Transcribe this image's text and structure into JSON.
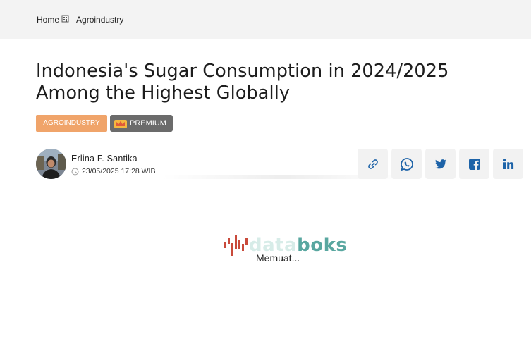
{
  "breadcrumb": {
    "home": "Home",
    "current": "Agroindustry"
  },
  "article": {
    "title": "Indonesia's Sugar Consumption in 2024/2025 Among the Highest Globally",
    "category_tag": "AGROINDUSTRY",
    "premium_label": "PREMIUM"
  },
  "author": {
    "name": "Erlina F. Santika",
    "date": "23/05/2025 17:28 WIB"
  },
  "share": {
    "icons": [
      "link-icon",
      "whatsapp-icon",
      "twitter-icon",
      "facebook-icon",
      "linkedin-icon"
    ]
  },
  "loader": {
    "logo_text_a": "data",
    "logo_text_b": "boks",
    "status": "Memuat..."
  },
  "colors": {
    "breadcrumb_bg": "#f3f3f3",
    "tag": "#f0a46a",
    "premium": "#6b6b6b",
    "share_icon": "#1d63a8",
    "logo_red": "#c94a3b",
    "logo_teal": "#59a7a0"
  }
}
